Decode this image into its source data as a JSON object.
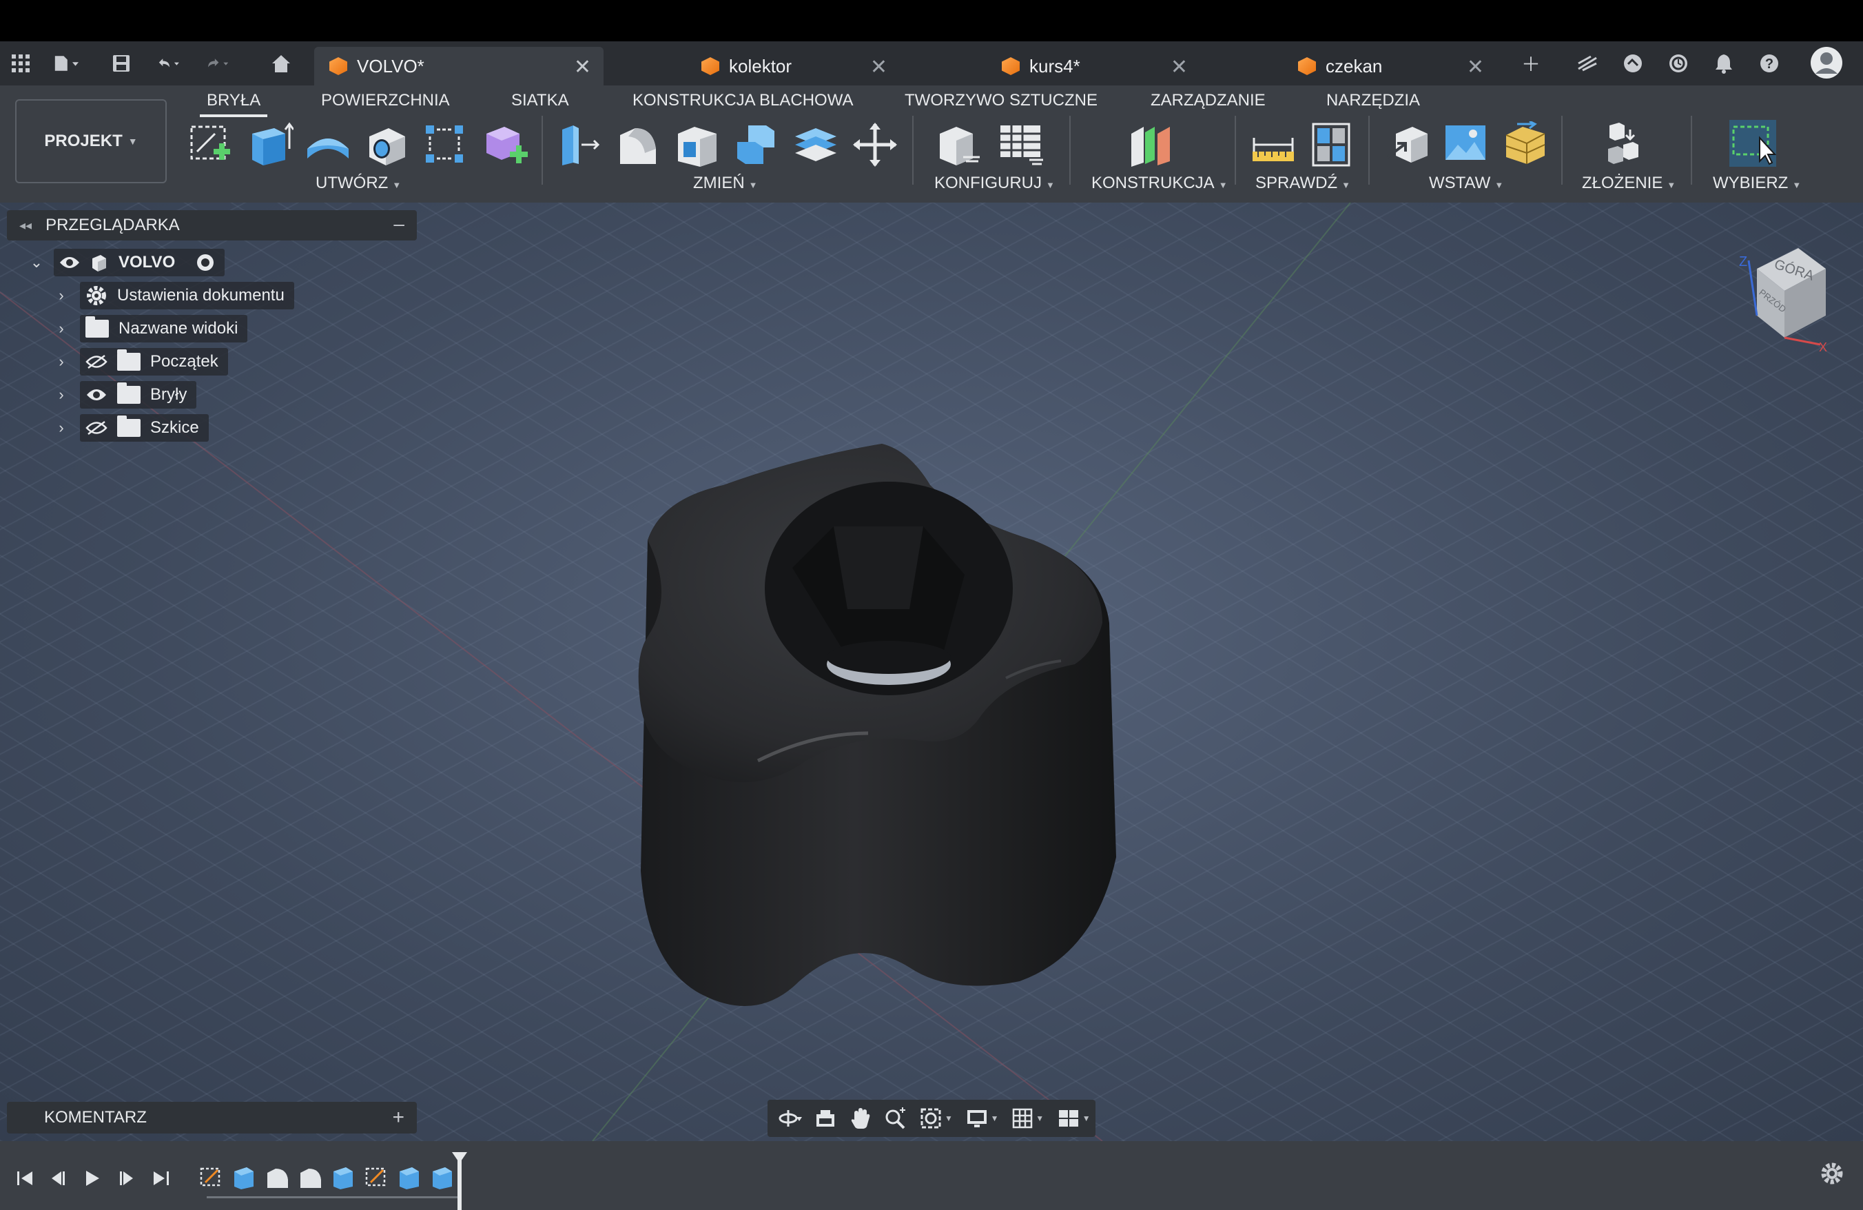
{
  "tabs": [
    {
      "label": "VOLVO*",
      "active": true
    },
    {
      "label": "kolektor",
      "active": false
    },
    {
      "label": "kurs4*",
      "active": false
    },
    {
      "label": "czekan",
      "active": false
    }
  ],
  "ribbon": {
    "workspace": "PROJEKT",
    "tabs": [
      "BRYŁA",
      "POWIERZCHNIA",
      "SIATKA",
      "KONSTRUKCJA BLACHOWA",
      "TWORZYWO SZTUCZNE",
      "ZARZĄDZANIE",
      "NARZĘDZIA"
    ],
    "groups": [
      "UTWÓRZ",
      "ZMIEŃ",
      "KONFIGURUJ",
      "KONSTRUKCJA",
      "SPRAWDŹ",
      "WSTAW",
      "ZŁOŻENIE",
      "WYBIERZ"
    ]
  },
  "browser": {
    "title": "PRZEGLĄDARKA",
    "root": "VOLVO",
    "items": [
      "Ustawienia dokumentu",
      "Nazwane widoki",
      "Początek",
      "Bryły",
      "Szkice"
    ]
  },
  "comment": {
    "title": "KOMENTARZ"
  },
  "viewcube": {
    "face_top": "GÓRA",
    "face_front": "PRZÓD",
    "axis_z": "Z",
    "axis_x": "X"
  },
  "colors": {
    "accent_orange": "#f08a24",
    "ribbon_bg": "#3b3f45",
    "tabbar_bg": "#2b2e33",
    "viewport_bg": "#4a5568"
  }
}
